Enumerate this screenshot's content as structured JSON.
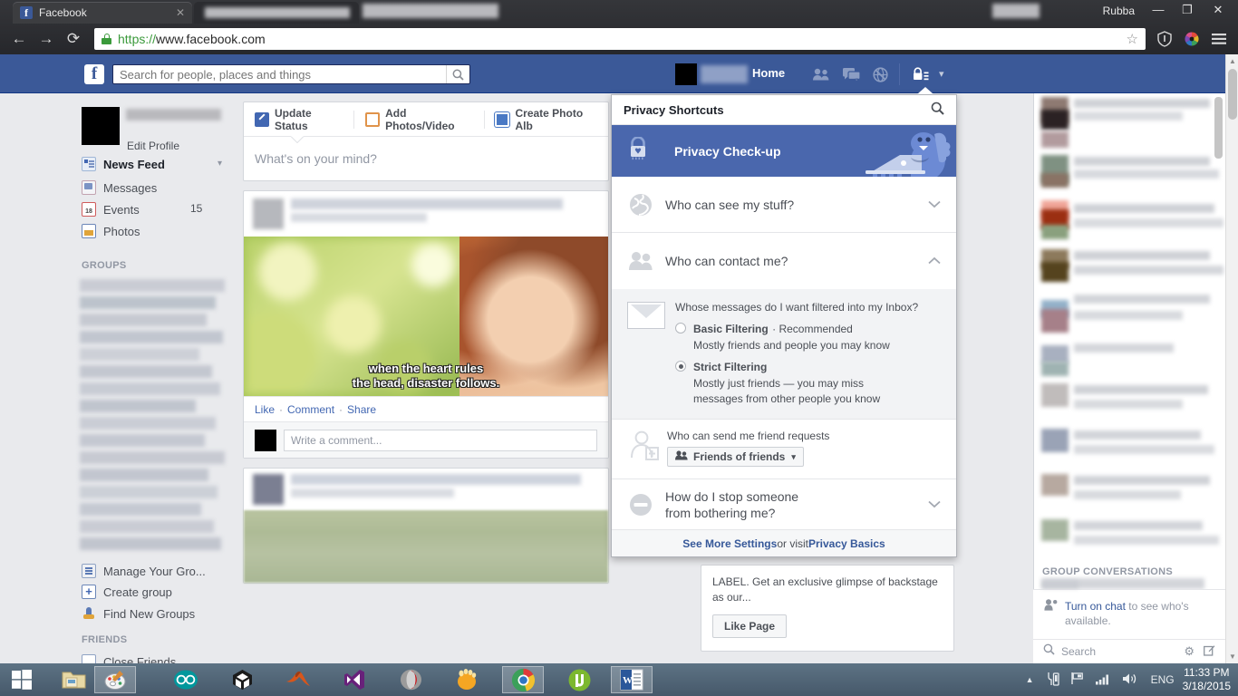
{
  "browser": {
    "tabs": [
      {
        "title": "Facebook",
        "favicon": "facebook-icon",
        "close": "✕"
      },
      {
        "title": "",
        "favicon": "blurred-icon",
        "close": "✕"
      }
    ],
    "window_user": "Rubba",
    "window_controls": {
      "minimize": "—",
      "maximize": "❐",
      "close": "✕"
    },
    "nav": {
      "back": "←",
      "forward": "→",
      "reload": "⟳"
    },
    "omnibox": {
      "scheme": "https://",
      "rest": "www.facebook.com",
      "lock_icon": "lock-icon",
      "star_icon": "☆"
    },
    "extensions": [
      {
        "name": "shield-extension-icon",
        "glyph": "⛨"
      },
      {
        "name": "color-wheel-extension-icon",
        "glyph": "◉"
      },
      {
        "name": "chrome-menu-icon",
        "glyph": "≡"
      }
    ]
  },
  "fbheader": {
    "logo": "f",
    "search_placeholder": "Search for people, places and things",
    "search_value": "",
    "search_icon": "🔍",
    "home_label": "Home",
    "icons": [
      {
        "name": "friend-requests-icon",
        "glyph": "👥"
      },
      {
        "name": "messages-icon",
        "glyph": "💬"
      },
      {
        "name": "notifications-globe-icon",
        "glyph": "🌐"
      }
    ],
    "privacy_icon": "privacy-lock-icon",
    "caret": "▾"
  },
  "sidebar": {
    "edit_profile": "Edit Profile",
    "items": [
      {
        "label": "News Feed",
        "icon": "news-feed-icon",
        "count": "",
        "bold": true
      },
      {
        "label": "Messages",
        "icon": "messages-icon",
        "count": ""
      },
      {
        "label": "Events",
        "icon": "events-icon",
        "count": "15"
      },
      {
        "label": "Photos",
        "icon": "photos-icon",
        "count": ""
      }
    ],
    "groups_header": "GROUPS",
    "group_items": [
      {
        "label": "Manage Your Gro...",
        "icon": "manage-groups-icon"
      },
      {
        "label": "Create group",
        "icon": "create-group-icon"
      },
      {
        "label": "Find New Groups",
        "icon": "find-groups-icon"
      }
    ],
    "friends_header": "FRIENDS",
    "friends_items": [
      {
        "label": "Close Friends",
        "icon": "close-friends-icon"
      }
    ],
    "newsfeed_caret": "▾"
  },
  "composer": {
    "tabs": [
      {
        "label": "Update Status",
        "icon": "pencil-icon",
        "active": true
      },
      {
        "label": "Add Photos/Video",
        "icon": "photo-icon",
        "active": false
      },
      {
        "label": "Create Photo Alb",
        "icon": "album-icon",
        "active": false
      }
    ],
    "placeholder": "What's on your mind?"
  },
  "feed": {
    "post1": {
      "caption_line1": "when the heart rules",
      "caption_line2": "the head, disaster follows.",
      "actions": [
        "Like",
        "Comment",
        "Share"
      ],
      "action_sep": "·",
      "comment_placeholder": "Write a comment..."
    },
    "post2": {
      "actions": []
    },
    "right_post": {
      "text": "LABEL. Get an exclusive glimpse of backstage as our...",
      "like_page": "Like Page"
    }
  },
  "privacy_dropdown": {
    "title": "Privacy Shortcuts",
    "search_icon": "🔍",
    "checkup": {
      "label": "Privacy Check-up",
      "icon": "privacy-lock-icon",
      "bg": "#4a67ad"
    },
    "rows": [
      {
        "label": "Who can see my stuff?",
        "icon": "globe-icon",
        "chevron": "⌄",
        "expanded": false
      },
      {
        "label": "Who can contact me?",
        "icon": "people-icon",
        "chevron": "⌃",
        "expanded": true
      }
    ],
    "filtering": {
      "question": "Whose messages do I want filtered into my Inbox?",
      "icon": "envelope-icon",
      "options": [
        {
          "title": "Basic Filtering",
          "recommended": "· Recommended",
          "sub": "Mostly friends and people you may know",
          "selected": false
        },
        {
          "title": "Strict Filtering",
          "recommended": "",
          "sub_line1": "Mostly just friends — you may miss",
          "sub_line2": "messages from other people you know",
          "selected": true
        }
      ]
    },
    "friend_requests": {
      "label": "Who can send me friend requests",
      "icon": "add-friend-icon",
      "selected": "Friends of friends",
      "select_icon": "👥",
      "caret": "▾"
    },
    "bothering": {
      "line1": "How do I stop someone",
      "line2": "from bothering me?",
      "icon": "block-icon",
      "chevron": "⌄"
    },
    "footer": {
      "link1": "See More Settings",
      "mid": " or visit ",
      "link2": "Privacy Basics"
    }
  },
  "right_rail": {
    "group_conversations_header": "GROUP CONVERSATIONS",
    "chat": {
      "link": "Turn on chat",
      "rest": " to see who's available.",
      "person_icon": "person-status-icon",
      "search_placeholder": "Search",
      "search_icon": "🔍",
      "gear_icon": "⚙",
      "compose_icon": "✎"
    }
  },
  "taskbar": {
    "start": "windows-start-icon",
    "apps": [
      {
        "name": "file-explorer-icon",
        "active": false
      },
      {
        "name": "paint-icon",
        "active": true
      },
      {
        "name": "arduino-icon",
        "active": false
      },
      {
        "name": "unity-icon",
        "active": false
      },
      {
        "name": "matlab-icon",
        "active": false
      },
      {
        "name": "visual-studio-icon",
        "active": false
      },
      {
        "name": "opera-icon",
        "active": false
      },
      {
        "name": "gnome-icon",
        "active": false
      },
      {
        "name": "chrome-icon",
        "active": true
      },
      {
        "name": "utorrent-icon",
        "active": false
      },
      {
        "name": "word-icon",
        "active": true
      }
    ],
    "tray": {
      "show_hidden": "▲",
      "icons": [
        {
          "name": "action-center-icon",
          "glyph": "⚑"
        },
        {
          "name": "flag-icon",
          "glyph": "⚐"
        },
        {
          "name": "network-icon",
          "glyph": "▆"
        },
        {
          "name": "volume-icon",
          "glyph": "🔊"
        }
      ],
      "language": "ENG",
      "time": "11:33 PM",
      "date": "3/18/2015"
    }
  },
  "colors": {
    "fb_blue": "#3b5998",
    "fb_link": "#365899",
    "checkup_bg": "#4a67ad",
    "page_bg": "#e9eaed",
    "taskbar": "#5d7384"
  }
}
